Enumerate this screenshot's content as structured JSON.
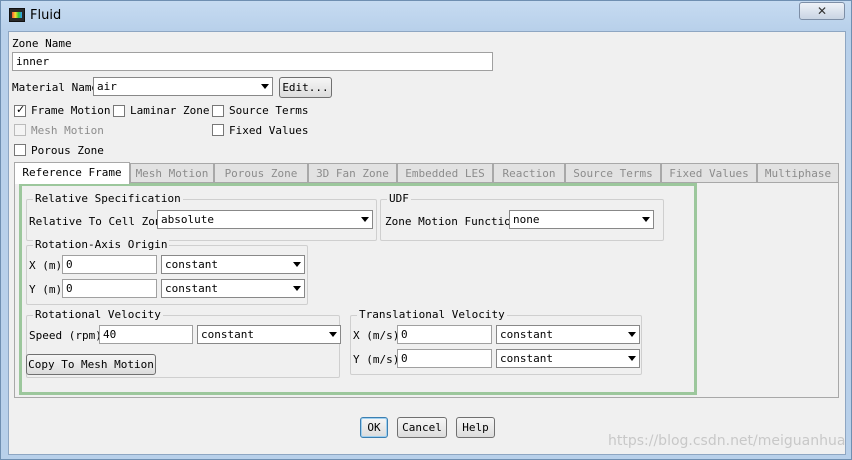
{
  "window": {
    "title": "Fluid"
  },
  "zone": {
    "label": "Zone Name",
    "value": "inner"
  },
  "material": {
    "label": "Material Name",
    "value": "air",
    "edit_button": "Edit..."
  },
  "options": {
    "frame_motion": "Frame Motion",
    "laminar_zone": "Laminar Zone",
    "source_terms": "Source Terms",
    "mesh_motion": "Mesh Motion",
    "fixed_values": "Fixed Values",
    "porous_zone": "Porous Zone"
  },
  "tabs": [
    "Reference Frame",
    "Mesh Motion",
    "Porous Zone",
    "3D Fan Zone",
    "Embedded LES",
    "Reaction",
    "Source Terms",
    "Fixed Values",
    "Multiphase"
  ],
  "relative_spec": {
    "title": "Relative Specification",
    "label": "Relative To Cell Zone",
    "value": "absolute"
  },
  "udf": {
    "title": "UDF",
    "label": "Zone Motion Function",
    "value": "none"
  },
  "rotation_origin": {
    "title": "Rotation-Axis Origin",
    "x_label": "X (m)",
    "x_value": "0",
    "x_method": "constant",
    "y_label": "Y (m)",
    "y_value": "0",
    "y_method": "constant"
  },
  "rotational_velocity": {
    "title": "Rotational Velocity",
    "speed_label": "Speed (rpm)",
    "speed_value": "40",
    "speed_method": "constant",
    "copy_button": "Copy To Mesh Motion"
  },
  "translational_velocity": {
    "title": "Translational Velocity",
    "x_label": "X (m/s)",
    "x_value": "0",
    "x_method": "constant",
    "y_label": "Y (m/s)",
    "y_value": "0",
    "y_method": "constant"
  },
  "buttons": {
    "ok": "OK",
    "cancel": "Cancel",
    "help": "Help"
  },
  "watermark": "https://blog.csdn.net/meiguanhua"
}
